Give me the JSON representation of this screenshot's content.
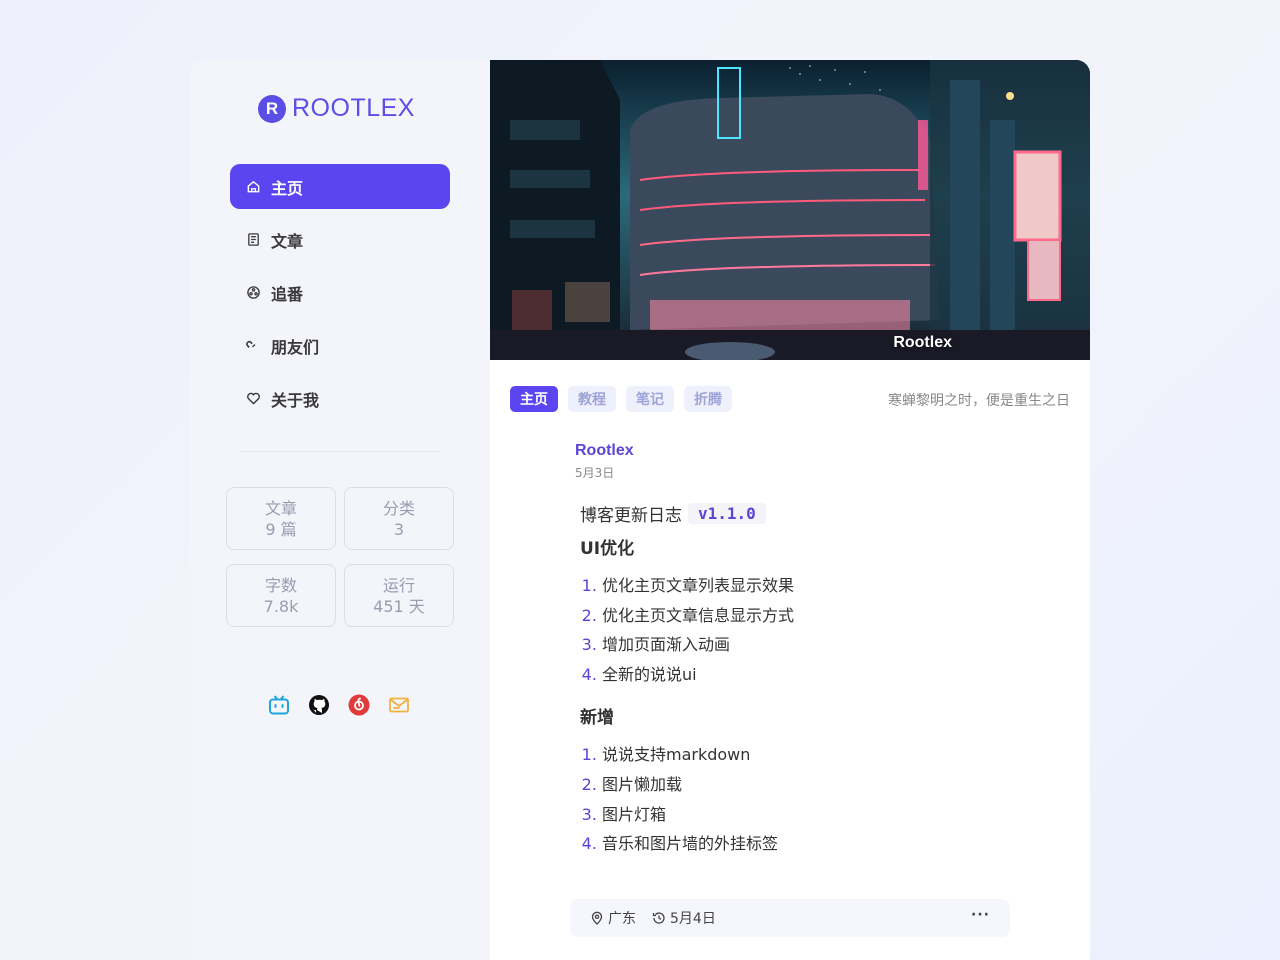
{
  "brand": {
    "mark": "R",
    "name": "ROOTLEX"
  },
  "nav": [
    {
      "label": "主页",
      "icon": "home-icon",
      "active": true
    },
    {
      "label": "文章",
      "icon": "document-icon",
      "active": false
    },
    {
      "label": "追番",
      "icon": "film-reel-icon",
      "active": false
    },
    {
      "label": "朋友们",
      "icon": "link-icon",
      "active": false
    },
    {
      "label": "关于我",
      "icon": "heart-icon",
      "active": false
    }
  ],
  "stats": [
    {
      "label": "文章",
      "value": "9 篇"
    },
    {
      "label": "分类",
      "value": "3"
    },
    {
      "label": "字数",
      "value": "7.8k"
    },
    {
      "label": "运行",
      "value": "451 天"
    }
  ],
  "socials": [
    "bilibili-icon",
    "github-icon",
    "netease-music-icon",
    "mail-icon"
  ],
  "hero": {
    "caption": "Rootlex"
  },
  "tabs": [
    {
      "label": "主页",
      "active": true
    },
    {
      "label": "教程",
      "active": false
    },
    {
      "label": "笔记",
      "active": false
    },
    {
      "label": "折腾",
      "active": false
    }
  ],
  "motto": "寒蝉黎明之时，便是重生之日",
  "post": {
    "author": "Rootlex",
    "date": "5月3日",
    "title": "博客更新日志",
    "version": "v1.1.0",
    "sections": [
      {
        "heading": "UI优化",
        "items": [
          "优化主页文章列表显示效果",
          "优化主页文章信息显示方式",
          "增加页面渐入动画",
          "全新的说说ui"
        ]
      },
      {
        "heading": "新增",
        "items": [
          "说说支持markdown",
          "图片懒加载",
          "图片灯箱",
          "音乐和图片墙的外挂标签"
        ]
      }
    ],
    "location": "广东",
    "updated": "5月4日",
    "more": "···"
  },
  "colors": {
    "accent": "#5b45f0",
    "brand": "#5b4ee6"
  }
}
